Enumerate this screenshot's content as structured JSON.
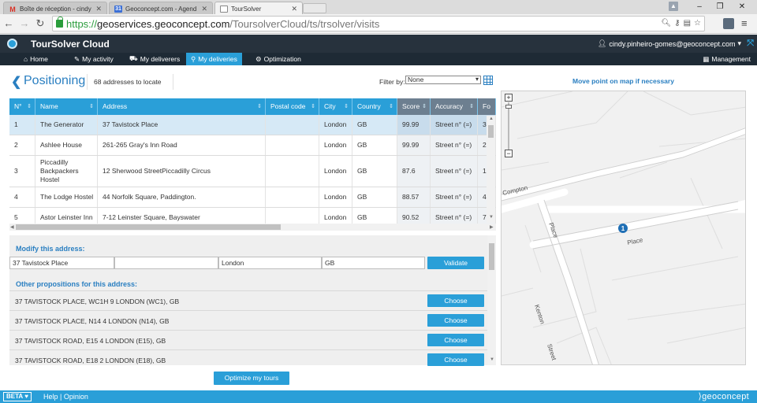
{
  "browser": {
    "tabs": [
      {
        "label": "Boîte de réception - cindy",
        "favicon": "gmail-icon",
        "color": "#d93025",
        "glyph": "M"
      },
      {
        "label": "Geoconcept.com - Agend",
        "favicon": "calendar-icon",
        "color": "#3b6fd6",
        "glyph": "31"
      },
      {
        "label": "TourSolver",
        "favicon": "page-icon",
        "color": "#ffffff",
        "glyph": ""
      }
    ],
    "url": {
      "scheme": "https://",
      "host": "geoservices.geoconcept.com",
      "path": "/ToursolverCloud/ts/trsolver/visits"
    }
  },
  "app": {
    "title": "TourSolver Cloud",
    "user": "cindy.pinheiro-gomes@geoconcept.com",
    "nav": [
      {
        "label": "Home",
        "icon": "home-icon"
      },
      {
        "label": "My activity",
        "icon": "pencil-icon"
      },
      {
        "label": "My deliverers",
        "icon": "car-icon"
      },
      {
        "label": "My deliveries",
        "icon": "pin-icon"
      },
      {
        "label": "Optimization",
        "icon": "gear-icon"
      }
    ],
    "management": "Management"
  },
  "positioning": {
    "title": "Positioning",
    "count_text": "68 addresses to locate",
    "filter_label": "Filter by:",
    "filter_value": "None"
  },
  "table": {
    "columns": [
      "N°",
      "Name",
      "Address",
      "Postal code",
      "City",
      "Country",
      "Score",
      "Accuracy",
      "Fo"
    ],
    "rows": [
      {
        "n": "1",
        "name": "The Generator",
        "address": "37 Tavistock Place",
        "postal": "",
        "city": "London",
        "country": "GB",
        "score": "99.99",
        "accuracy": "Street n° (=)",
        "fo": "3"
      },
      {
        "n": "2",
        "name": "Ashlee House",
        "address": "261-265 Gray's Inn Road",
        "postal": "",
        "city": "London",
        "country": "GB",
        "score": "99.99",
        "accuracy": "Street n° (=)",
        "fo": "2"
      },
      {
        "n": "3",
        "name": "Piccadilly Backpackers Hostel",
        "address": "12 Sherwood StreetPiccadilly Circus",
        "postal": "",
        "city": "London",
        "country": "GB",
        "score": "87.6",
        "accuracy": "Street n° (=)",
        "fo": "1"
      },
      {
        "n": "4",
        "name": "The Lodge Hostel",
        "address": "44 Norfolk Square, Paddington.",
        "postal": "",
        "city": "London",
        "country": "GB",
        "score": "88.57",
        "accuracy": "Street n° (=)",
        "fo": "4"
      },
      {
        "n": "5",
        "name": "Astor Leinster Inn",
        "address": "7-12 Leinster Square, Bayswater",
        "postal": "",
        "city": "London",
        "country": "GB",
        "score": "90.52",
        "accuracy": "Street n° (=)",
        "fo": "7"
      }
    ]
  },
  "modify": {
    "title": "Modify this address:",
    "address": "37 Tavistock Place",
    "postal": "",
    "city": "London",
    "country": "GB",
    "validate": "Validate"
  },
  "propositions": {
    "title": "Other propositions for this address:",
    "choose_label": "Choose",
    "items": [
      "37 TAVISTOCK PLACE, WC1H 9 LONDON (WC1), GB",
      "37 TAVISTOCK PLACE, N14 4 LONDON (N14), GB",
      "37 TAVISTOCK ROAD, E15 4 LONDON (E15), GB",
      "37 TAVISTOCK ROAD, E18 2 LONDON (E18), GB"
    ]
  },
  "optimize_label": "Optimize my tours",
  "map": {
    "title": "Move point on map if necessary",
    "marker_label": "1",
    "streets": [
      "Compton",
      "Place",
      "Place",
      "Kenton",
      "Street"
    ]
  },
  "footer": {
    "beta": "BETA",
    "links": "Help | Opinion",
    "brand": "geoconcept"
  },
  "colors": {
    "accent": "#2a9fd8",
    "header": "#27323d",
    "link": "#2a7fc1"
  }
}
